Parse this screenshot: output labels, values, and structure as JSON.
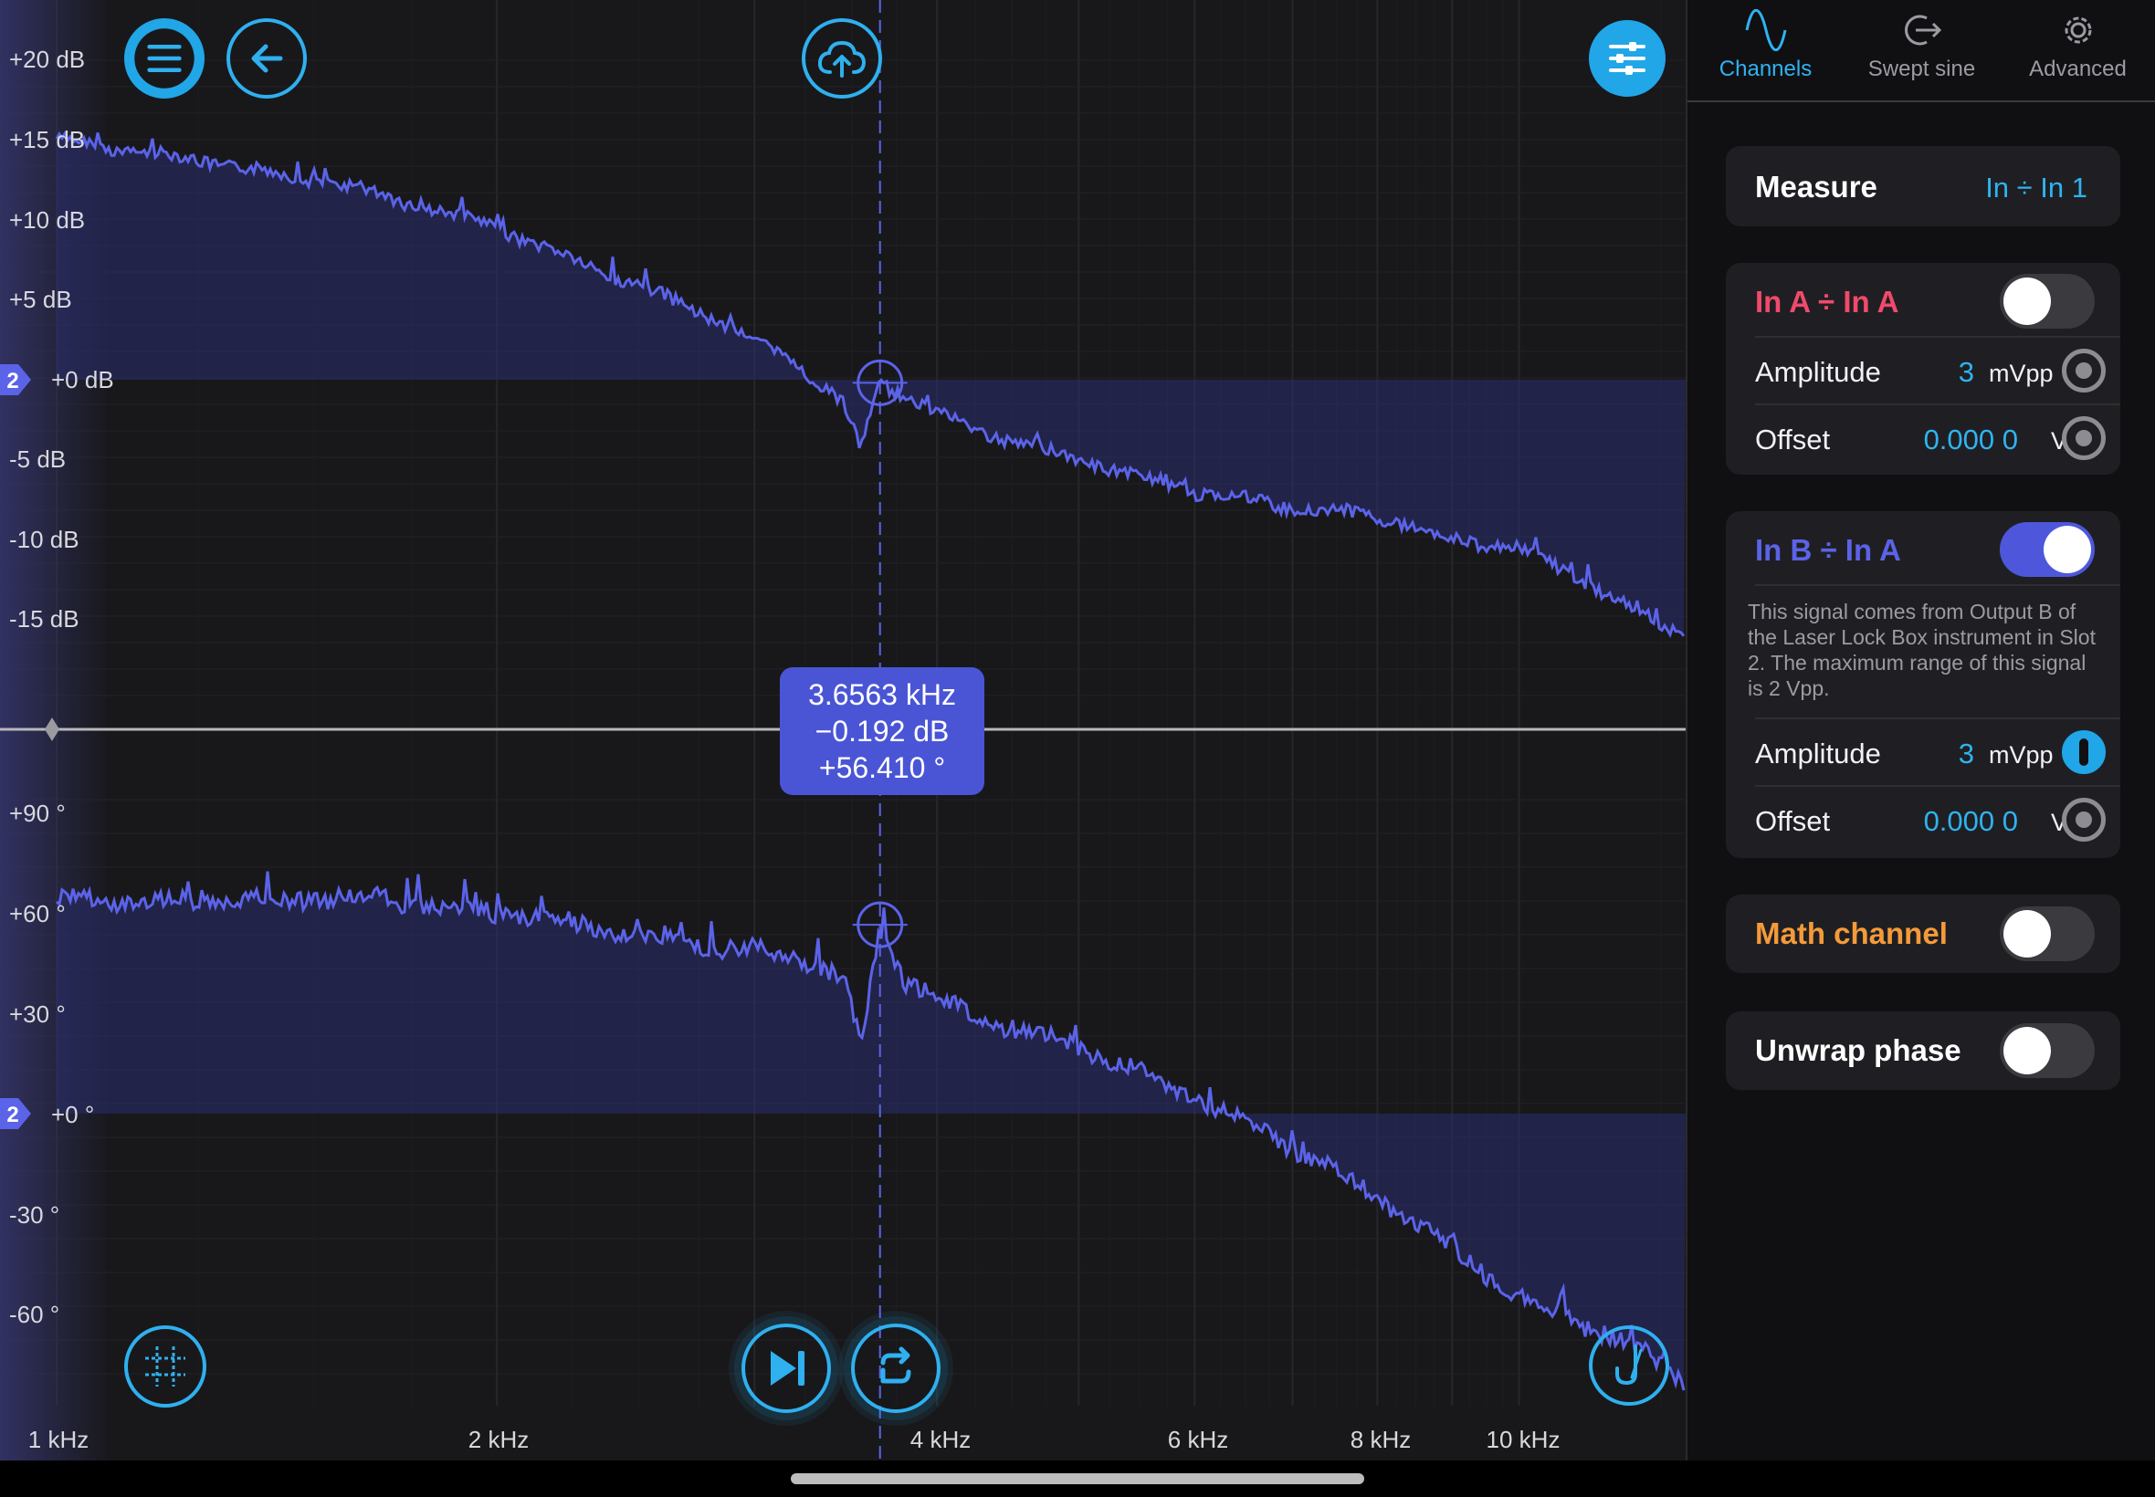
{
  "plot": {
    "magnitude_labels": [
      "+20 dB",
      "+15 dB",
      "+10 dB",
      "+5 dB",
      "+0 dB",
      "-5 dB",
      "-10 dB",
      "-15 dB"
    ],
    "phase_labels": [
      "+90 °",
      "+60 °",
      "+30 °",
      "+0 °",
      "-30 °",
      "-60 °"
    ],
    "freq_labels": [
      "1 kHz",
      "2 kHz",
      "4 kHz",
      "6 kHz",
      "8 kHz",
      "10 kHz"
    ],
    "channel_marker": "2",
    "colors": {
      "trace": "#5b63e8",
      "fill": "#2a2d6e",
      "accent": "#2fb0ef",
      "background": "#18181b"
    }
  },
  "chart_data": [
    {
      "type": "line",
      "ylabel": "",
      "xlabel": "",
      "x_scale": "log",
      "xlim_hz": [
        1000,
        13000
      ],
      "ylim": [
        -20,
        25
      ],
      "series": [
        {
          "x_hz": [
            1000,
            1300,
            1600,
            2000,
            2400,
            2800,
            3200,
            3450,
            3550,
            3600,
            3656,
            3800,
            4200,
            5000,
            6000,
            7000,
            8000,
            9000,
            10000,
            11000,
            12000,
            13000
          ],
          "values": [
            15,
            13.5,
            12,
            9.5,
            6.5,
            4,
            1,
            -1.5,
            -4.5,
            -2,
            -0.2,
            -1,
            -3,
            -5,
            -7,
            -8,
            -8.5,
            -10,
            -10.5,
            -12.5,
            -14.5,
            -16
          ]
        }
      ]
    },
    {
      "type": "line",
      "ylabel": "",
      "xlabel": "",
      "x_scale": "log",
      "xlim_hz": [
        1000,
        13000
      ],
      "ylim": [
        -90,
        110
      ],
      "series": [
        {
          "x_hz": [
            1000,
            1300,
            1600,
            2000,
            2400,
            2800,
            3200,
            3450,
            3550,
            3600,
            3656,
            3800,
            4200,
            5000,
            6000,
            7000,
            8000,
            9000,
            10000,
            11000,
            12000,
            13000
          ],
          "values": [
            64,
            63,
            65,
            60,
            55,
            50,
            47,
            40,
            20,
            38,
            56,
            40,
            30,
            20,
            5,
            -10,
            -25,
            -40,
            -55,
            -62,
            -70,
            -80
          ]
        }
      ]
    }
  ],
  "cursor": {
    "frequency": "3.6563 kHz",
    "magnitude": "−0.192 dB",
    "phase": "+56.410 °"
  },
  "sidebar": {
    "tabs": [
      {
        "label": "Channels",
        "icon": "sine-wave-icon",
        "active": true
      },
      {
        "label": "Swept sine",
        "icon": "swept-sine-icon",
        "active": false
      },
      {
        "label": "Advanced",
        "icon": "gear-icon",
        "active": false
      }
    ],
    "measure": {
      "label": "Measure",
      "value": "In ÷ In 1"
    },
    "channel_a": {
      "title": "In A ÷ In A",
      "color": "#f04a6a",
      "enabled": false,
      "amplitude_label": "Amplitude",
      "amplitude_value": "3",
      "amplitude_unit": "mVpp",
      "offset_label": "Offset",
      "offset_value": "0.000 0",
      "offset_unit": "V"
    },
    "channel_b": {
      "title": "In B ÷ In A",
      "color": "#5b63e8",
      "enabled": true,
      "description": "This signal comes from Output B of the Laser Lock Box instrument in Slot 2. The maximum range of this signal is 2 Vpp.",
      "amplitude_label": "Amplitude",
      "amplitude_value": "3",
      "amplitude_unit": "mVpp",
      "offset_label": "Offset",
      "offset_value": "0.000 0",
      "offset_unit": "V"
    },
    "math_channel": {
      "label": "Math channel",
      "color": "#f59a3a",
      "enabled": false
    },
    "unwrap_phase": {
      "label": "Unwrap phase",
      "enabled": false
    }
  }
}
